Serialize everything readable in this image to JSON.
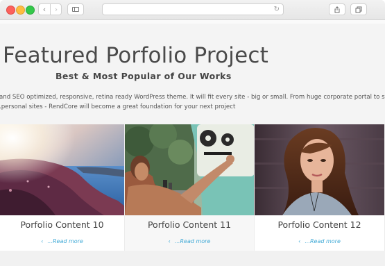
{
  "browser": {
    "back_icon": "chevron-left-icon",
    "forward_icon": "chevron-right-icon",
    "sidebar_icon": "sidebar-icon",
    "reload_icon": "reload-icon",
    "share_icon": "share-icon",
    "tabs_icon": "tabs-icon",
    "back_glyph": "‹",
    "forward_glyph": "›",
    "reload_glyph": "↻"
  },
  "hero": {
    "title": "Featured Porfolio Project",
    "subtitle": "Best & Most Popular of Our Works",
    "description_line1": "and SEO optimized, responsive, retina ready WordPress theme. It will fit every site - big or small. From huge corporate portal to studio or",
    "description_line2": ".personal sites - RendCore will become a great foundation for your next project"
  },
  "cards": [
    {
      "title": "Porfolio Content 10",
      "read_more": "...Read more",
      "arrow": "‹"
    },
    {
      "title": "Porfolio Content 11",
      "read_more": "...Read more",
      "arrow": "‹"
    },
    {
      "title": "Porfolio Content 12",
      "read_more": "...Read more",
      "arrow": "‹"
    }
  ],
  "colors": {
    "accent": "#3fa9d6",
    "title_text": "#4a4a4a"
  }
}
